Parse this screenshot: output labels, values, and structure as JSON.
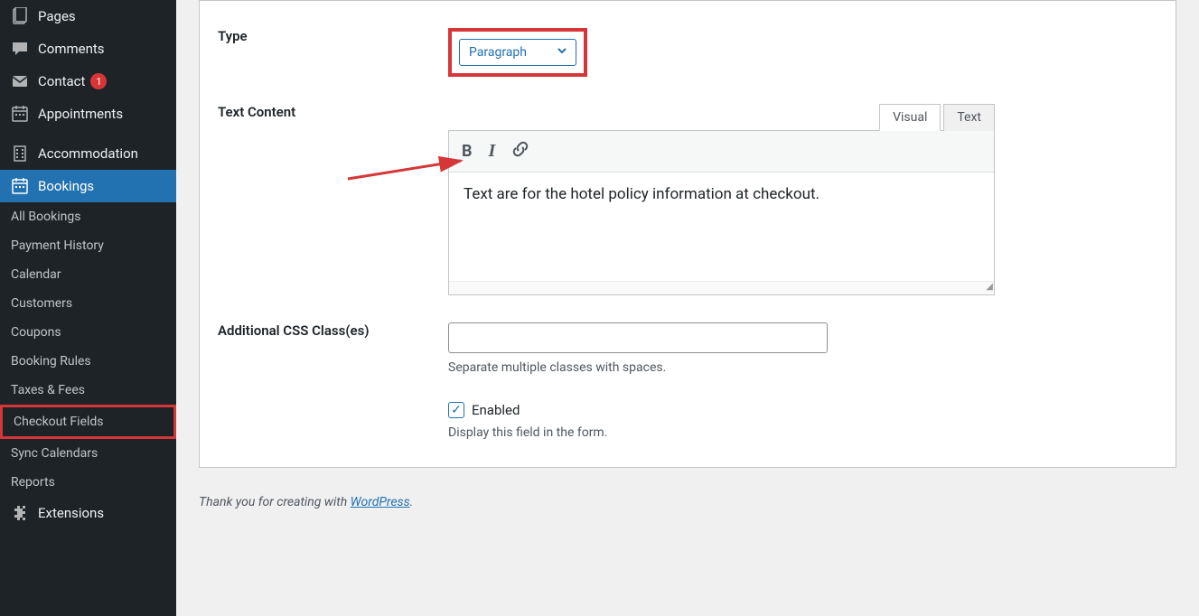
{
  "sidebar": {
    "main_items": [
      {
        "label": "Pages",
        "icon": "pages"
      },
      {
        "label": "Comments",
        "icon": "comment"
      },
      {
        "label": "Contact",
        "icon": "mail",
        "badge": "1"
      },
      {
        "label": "Appointments",
        "icon": "calendar"
      },
      {
        "label": "Accommodation",
        "icon": "building"
      },
      {
        "label": "Bookings",
        "icon": "calendar",
        "active": true
      }
    ],
    "sub_items": [
      {
        "label": "All Bookings"
      },
      {
        "label": "Payment History"
      },
      {
        "label": "Calendar"
      },
      {
        "label": "Customers"
      },
      {
        "label": "Coupons"
      },
      {
        "label": "Booking Rules"
      },
      {
        "label": "Taxes & Fees"
      },
      {
        "label": "Checkout Fields",
        "highlighted": true
      },
      {
        "label": "Sync Calendars"
      },
      {
        "label": "Reports"
      }
    ],
    "extensions_label": "Extensions"
  },
  "form": {
    "type_label": "Type",
    "type_value": "Paragraph",
    "text_content_label": "Text Content",
    "visual_tab": "Visual",
    "text_tab": "Text",
    "editor_content": "Text are for the hotel policy information at checkout.",
    "css_label": "Additional CSS Class(es)",
    "css_help": "Separate multiple classes with spaces.",
    "enabled_label": "Enabled",
    "enabled_help": "Display this field in the form."
  },
  "footer": {
    "prefix": "Thank you for creating with ",
    "link": "WordPress",
    "suffix": "."
  }
}
